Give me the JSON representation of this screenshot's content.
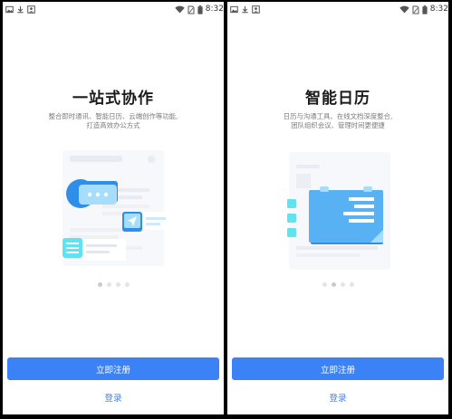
{
  "status_bar": {
    "time": "8:32",
    "icons": [
      "image-icon",
      "download-icon",
      "account-icon",
      "wifi-icon",
      "no-sim-icon",
      "battery-icon"
    ]
  },
  "screens": [
    {
      "title": "一站式协作",
      "subtitle_line1": "整合即时通讯、智能日历、云端创作等功能,",
      "subtitle_line2": "打造高效办公方式",
      "illustration": "collaboration-illustration",
      "active_page": 1
    },
    {
      "title": "智能日历",
      "subtitle_line1": "日历与沟通工具、在线文档深度整合,",
      "subtitle_line2": "团队组织会议、管理时间更便捷",
      "illustration": "calendar-illustration",
      "active_page": 2
    }
  ],
  "pagination_count": 4,
  "actions": {
    "register_label": "立即注册",
    "login_label": "登录"
  },
  "colors": {
    "primary": "#3b82f6",
    "illustration_blue": "#2f8fe8",
    "illustration_cyan": "#5fe3f0",
    "title": "#1b1b1b",
    "subtitle": "#7a7a7a"
  }
}
